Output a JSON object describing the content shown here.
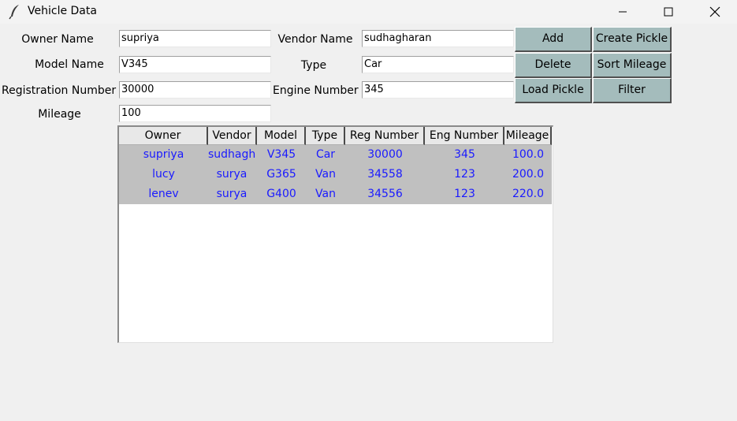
{
  "window": {
    "title": "Vehicle Data",
    "icons": {
      "app": "feather-icon",
      "minimize": "minimize-icon",
      "maximize": "maximize-icon",
      "close": "close-icon"
    }
  },
  "form": {
    "owner_name_label": "Owner Name",
    "owner_name_value": "supriya",
    "vendor_name_label": "Vendor Name",
    "vendor_name_value": "sudhagharan",
    "model_name_label": "Model Name",
    "model_name_value": "V345",
    "type_label": "Type",
    "type_value": "Car",
    "registration_number_label": "Registration Number",
    "registration_number_value": "30000",
    "engine_number_label": "Engine Number",
    "engine_number_value": "345",
    "mileage_label": "Mileage",
    "mileage_value": "100"
  },
  "buttons": {
    "add": "Add",
    "create_pickle": "Create Pickle",
    "delete": "Delete",
    "sort_mileage": "Sort Mileage",
    "load_pickle": "Load Pickle",
    "filter": "Filter"
  },
  "table": {
    "columns": [
      "Owner",
      "Vendor",
      "Model",
      "Type",
      "Reg Number",
      "Eng Number",
      "Mileage"
    ],
    "rows": [
      [
        "supriya",
        "sudhagh",
        "V345",
        "Car",
        "30000",
        "345",
        "100.0"
      ],
      [
        "lucy",
        "surya",
        "G365",
        "Van",
        "34558",
        "123",
        "200.0"
      ],
      [
        "lenev",
        "surya",
        "G400",
        "Van",
        "34556",
        "123",
        "220.0"
      ]
    ]
  },
  "colors": {
    "button_bg": "#a4bcbc",
    "row_bg": "#c0c0c0",
    "row_text": "#1a1aff",
    "window_bg": "#f0f0f0"
  }
}
